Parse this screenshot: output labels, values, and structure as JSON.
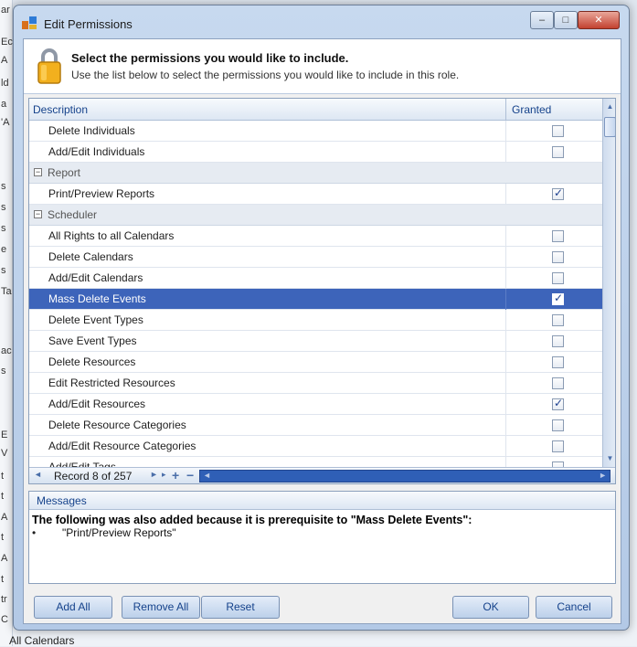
{
  "background": {
    "left_letters": [
      "ar",
      "Ec",
      "A",
      "ld",
      "a",
      "'A",
      "s",
      "s",
      "s",
      "e",
      "s",
      "Ta",
      "ac",
      "s",
      "E",
      "V",
      "t",
      "t",
      "A",
      "t",
      "A",
      "t",
      "tr",
      "C"
    ],
    "status_text": "All Calendars"
  },
  "dialog": {
    "title": "Edit Permissions",
    "controls": {
      "minimize": "–",
      "maximize": "□",
      "close": "✕"
    }
  },
  "header": {
    "title": "Select the permissions you would like to include.",
    "subtitle": "Use the list below to select the permissions you would like to include in this role."
  },
  "grid": {
    "columns": {
      "description": "Description",
      "granted": "Granted"
    },
    "rows": [
      {
        "type": "item",
        "label": "Delete Individuals",
        "granted": false
      },
      {
        "type": "item",
        "label": "Add/Edit Individuals",
        "granted": false
      },
      {
        "type": "group",
        "label": "Report"
      },
      {
        "type": "item",
        "label": "Print/Preview Reports",
        "granted": true
      },
      {
        "type": "group",
        "label": "Scheduler"
      },
      {
        "type": "item",
        "label": "All Rights to all Calendars",
        "granted": false
      },
      {
        "type": "item",
        "label": "Delete Calendars",
        "granted": false
      },
      {
        "type": "item",
        "label": "Add/Edit Calendars",
        "granted": false
      },
      {
        "type": "item",
        "label": "Mass Delete Events",
        "granted": true,
        "selected": true
      },
      {
        "type": "item",
        "label": "Delete Event Types",
        "granted": false
      },
      {
        "type": "item",
        "label": "Save Event Types",
        "granted": false
      },
      {
        "type": "item",
        "label": "Delete Resources",
        "granted": false
      },
      {
        "type": "item",
        "label": "Edit Restricted Resources",
        "granted": false
      },
      {
        "type": "item",
        "label": "Add/Edit Resources",
        "granted": true
      },
      {
        "type": "item",
        "label": "Delete Resource Categories",
        "granted": false
      },
      {
        "type": "item",
        "label": "Add/Edit Resource Categories",
        "granted": false
      },
      {
        "type": "item",
        "label": "Add/Edit Tags",
        "granted": false
      }
    ],
    "navigator": {
      "record_text": "Record 8 of 257"
    }
  },
  "messages": {
    "title": "Messages",
    "text": "The following was also added because it is prerequisite to \"Mass Delete Events\":",
    "bullet": "•",
    "items": [
      "\"Print/Preview Reports\""
    ]
  },
  "buttons": {
    "add_all": "Add All",
    "remove_all": "Remove All",
    "reset": "Reset",
    "ok": "OK",
    "cancel": "Cancel"
  },
  "colors": {
    "selection": "#3d64ba",
    "header_text": "#15428b"
  }
}
